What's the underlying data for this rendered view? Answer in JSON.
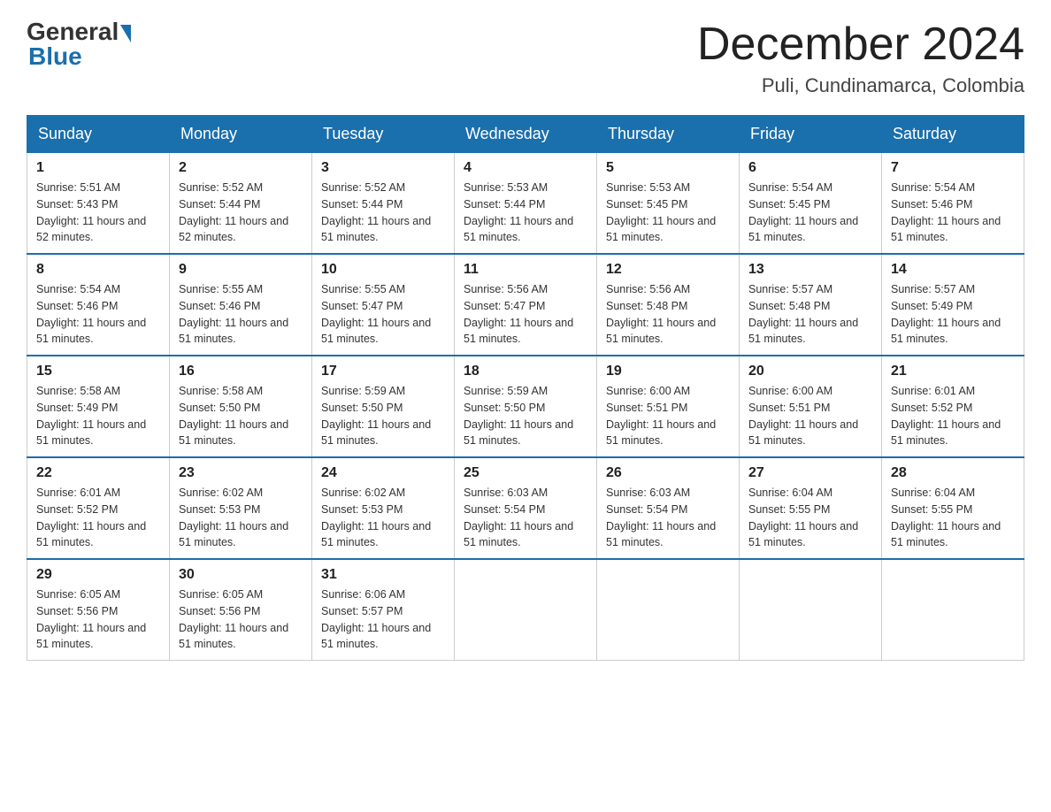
{
  "header": {
    "logo_general": "General",
    "logo_blue": "Blue",
    "month_title": "December 2024",
    "location": "Puli, Cundinamarca, Colombia"
  },
  "days_of_week": [
    "Sunday",
    "Monday",
    "Tuesday",
    "Wednesday",
    "Thursday",
    "Friday",
    "Saturday"
  ],
  "weeks": [
    [
      {
        "day": "1",
        "sunrise": "5:51 AM",
        "sunset": "5:43 PM",
        "daylight": "11 hours and 52 minutes."
      },
      {
        "day": "2",
        "sunrise": "5:52 AM",
        "sunset": "5:44 PM",
        "daylight": "11 hours and 52 minutes."
      },
      {
        "day": "3",
        "sunrise": "5:52 AM",
        "sunset": "5:44 PM",
        "daylight": "11 hours and 51 minutes."
      },
      {
        "day": "4",
        "sunrise": "5:53 AM",
        "sunset": "5:44 PM",
        "daylight": "11 hours and 51 minutes."
      },
      {
        "day": "5",
        "sunrise": "5:53 AM",
        "sunset": "5:45 PM",
        "daylight": "11 hours and 51 minutes."
      },
      {
        "day": "6",
        "sunrise": "5:54 AM",
        "sunset": "5:45 PM",
        "daylight": "11 hours and 51 minutes."
      },
      {
        "day": "7",
        "sunrise": "5:54 AM",
        "sunset": "5:46 PM",
        "daylight": "11 hours and 51 minutes."
      }
    ],
    [
      {
        "day": "8",
        "sunrise": "5:54 AM",
        "sunset": "5:46 PM",
        "daylight": "11 hours and 51 minutes."
      },
      {
        "day": "9",
        "sunrise": "5:55 AM",
        "sunset": "5:46 PM",
        "daylight": "11 hours and 51 minutes."
      },
      {
        "day": "10",
        "sunrise": "5:55 AM",
        "sunset": "5:47 PM",
        "daylight": "11 hours and 51 minutes."
      },
      {
        "day": "11",
        "sunrise": "5:56 AM",
        "sunset": "5:47 PM",
        "daylight": "11 hours and 51 minutes."
      },
      {
        "day": "12",
        "sunrise": "5:56 AM",
        "sunset": "5:48 PM",
        "daylight": "11 hours and 51 minutes."
      },
      {
        "day": "13",
        "sunrise": "5:57 AM",
        "sunset": "5:48 PM",
        "daylight": "11 hours and 51 minutes."
      },
      {
        "day": "14",
        "sunrise": "5:57 AM",
        "sunset": "5:49 PM",
        "daylight": "11 hours and 51 minutes."
      }
    ],
    [
      {
        "day": "15",
        "sunrise": "5:58 AM",
        "sunset": "5:49 PM",
        "daylight": "11 hours and 51 minutes."
      },
      {
        "day": "16",
        "sunrise": "5:58 AM",
        "sunset": "5:50 PM",
        "daylight": "11 hours and 51 minutes."
      },
      {
        "day": "17",
        "sunrise": "5:59 AM",
        "sunset": "5:50 PM",
        "daylight": "11 hours and 51 minutes."
      },
      {
        "day": "18",
        "sunrise": "5:59 AM",
        "sunset": "5:50 PM",
        "daylight": "11 hours and 51 minutes."
      },
      {
        "day": "19",
        "sunrise": "6:00 AM",
        "sunset": "5:51 PM",
        "daylight": "11 hours and 51 minutes."
      },
      {
        "day": "20",
        "sunrise": "6:00 AM",
        "sunset": "5:51 PM",
        "daylight": "11 hours and 51 minutes."
      },
      {
        "day": "21",
        "sunrise": "6:01 AM",
        "sunset": "5:52 PM",
        "daylight": "11 hours and 51 minutes."
      }
    ],
    [
      {
        "day": "22",
        "sunrise": "6:01 AM",
        "sunset": "5:52 PM",
        "daylight": "11 hours and 51 minutes."
      },
      {
        "day": "23",
        "sunrise": "6:02 AM",
        "sunset": "5:53 PM",
        "daylight": "11 hours and 51 minutes."
      },
      {
        "day": "24",
        "sunrise": "6:02 AM",
        "sunset": "5:53 PM",
        "daylight": "11 hours and 51 minutes."
      },
      {
        "day": "25",
        "sunrise": "6:03 AM",
        "sunset": "5:54 PM",
        "daylight": "11 hours and 51 minutes."
      },
      {
        "day": "26",
        "sunrise": "6:03 AM",
        "sunset": "5:54 PM",
        "daylight": "11 hours and 51 minutes."
      },
      {
        "day": "27",
        "sunrise": "6:04 AM",
        "sunset": "5:55 PM",
        "daylight": "11 hours and 51 minutes."
      },
      {
        "day": "28",
        "sunrise": "6:04 AM",
        "sunset": "5:55 PM",
        "daylight": "11 hours and 51 minutes."
      }
    ],
    [
      {
        "day": "29",
        "sunrise": "6:05 AM",
        "sunset": "5:56 PM",
        "daylight": "11 hours and 51 minutes."
      },
      {
        "day": "30",
        "sunrise": "6:05 AM",
        "sunset": "5:56 PM",
        "daylight": "11 hours and 51 minutes."
      },
      {
        "day": "31",
        "sunrise": "6:06 AM",
        "sunset": "5:57 PM",
        "daylight": "11 hours and 51 minutes."
      },
      null,
      null,
      null,
      null
    ]
  ],
  "labels": {
    "sunrise_prefix": "Sunrise: ",
    "sunset_prefix": "Sunset: ",
    "daylight_prefix": "Daylight: "
  }
}
